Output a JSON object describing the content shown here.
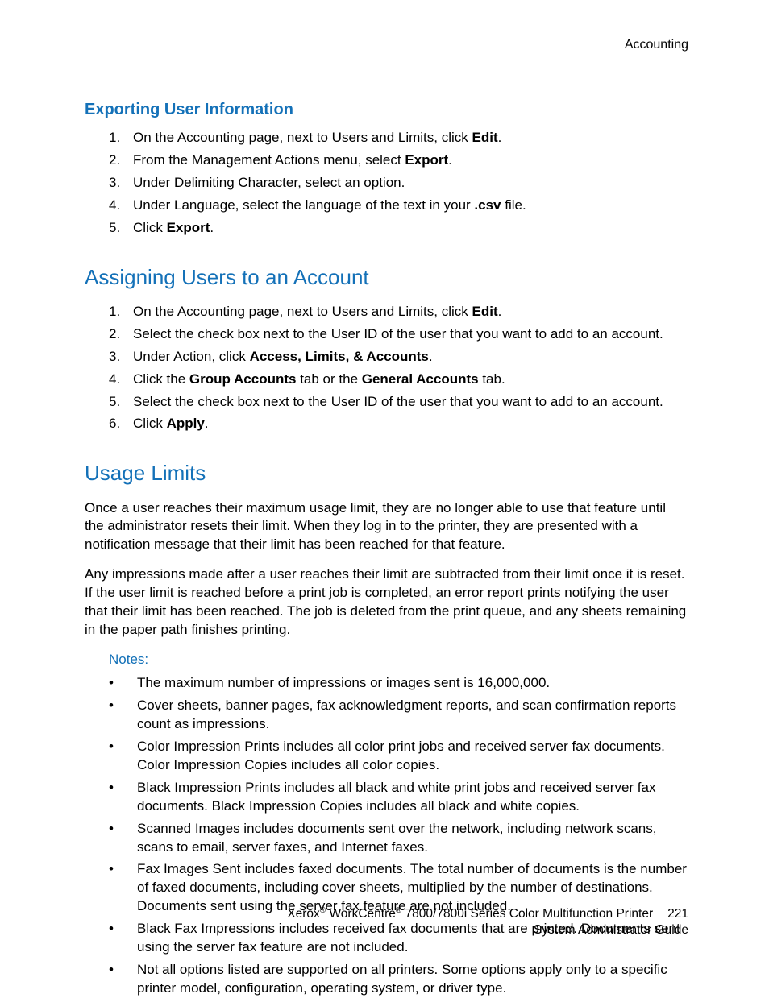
{
  "header": {
    "section": "Accounting"
  },
  "s1": {
    "title": "Exporting User Information",
    "items": [
      {
        "pre": "On the Accounting page, next to Users and Limits, click ",
        "b": "Edit",
        "post": "."
      },
      {
        "pre": "From the Management Actions menu, select ",
        "b": "Export",
        "post": "."
      },
      {
        "pre": "Under Delimiting Character, select an option.",
        "b": "",
        "post": ""
      },
      {
        "pre": "Under Language, select the language of the text in your ",
        "b": ".csv",
        "post": " file."
      },
      {
        "pre": "Click ",
        "b": "Export",
        "post": "."
      }
    ]
  },
  "s2": {
    "title": "Assigning Users to an Account",
    "i1": {
      "pre": "On the Accounting page, next to Users and Limits, click ",
      "b": "Edit",
      "post": "."
    },
    "i2": "Select the check box next to the User ID of the user that you want to add to an account.",
    "i3": {
      "pre": "Under Action, click ",
      "b": "Access, Limits, & Accounts",
      "post": "."
    },
    "i4": {
      "pre": "Click the ",
      "b1": "Group Accounts",
      "mid": " tab or the ",
      "b2": "General Accounts",
      "post": " tab."
    },
    "i5": "Select the check box next to the User ID of the user that you want to add to an account.",
    "i6": {
      "pre": "Click ",
      "b": "Apply",
      "post": "."
    }
  },
  "s3": {
    "title": "Usage Limits",
    "p1": "Once a user reaches their maximum usage limit, they are no longer able to use that feature until the administrator resets their limit. When they log in to the printer, they are presented with a notification message that their limit has been reached for that feature.",
    "p2": "Any impressions made after a user reaches their limit are subtracted from their limit once it is reset. If the user limit is reached before a print job is completed, an error report prints notifying the user that their limit has been reached. The job is deleted from the print queue, and any sheets remaining in the paper path finishes printing.",
    "notes_label": "Notes:",
    "notes": [
      "The maximum number of impressions or images sent is 16,000,000.",
      "Cover sheets, banner pages, fax acknowledgment reports, and scan confirmation reports count as impressions.",
      "Color Impression Prints includes all color print jobs and received server fax documents. Color Impression Copies includes all color copies.",
      "Black Impression Prints includes all black and white print jobs and received server fax documents. Black Impression Copies includes all black and white copies.",
      "Scanned Images includes documents sent over the network, including network scans, scans to email, server faxes, and Internet faxes.",
      "Fax Images Sent includes faxed documents. The total number of documents is the number of faxed documents, including cover sheets, multiplied by the number of destinations. Documents sent using the server fax feature are not included.",
      "Black Fax Impressions includes received fax documents that are printed. Documents sent using the server fax feature are not included.",
      "Not all options listed are supported on all printers. Some options apply only to a specific printer model, configuration, operating system, or driver type."
    ]
  },
  "footer": {
    "brand1": "Xerox",
    "brand2": " WorkCentre",
    "model": " 7800/7800i Series Color Multifunction Printer",
    "page": "221",
    "line2": "System Administrator Guide"
  }
}
